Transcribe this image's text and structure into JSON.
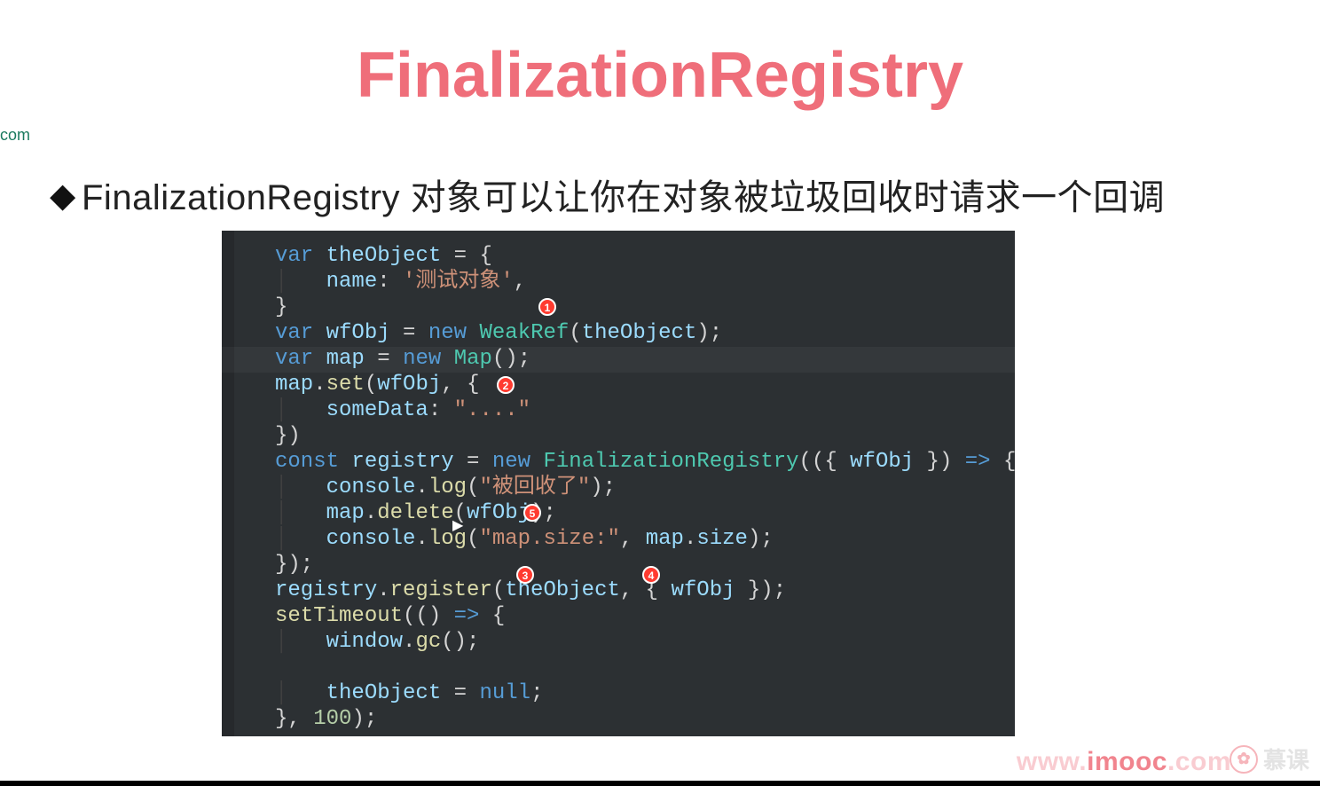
{
  "title": "FinalizationRegistry",
  "left_fragment": "com",
  "bullet_marker": "◆",
  "bullet_text": "FinalizationRegistry 对象可以让你在对象被垃圾回收时请求一个回调",
  "annotations": {
    "a1": "1",
    "a2": "2",
    "a3": "3",
    "a4": "4",
    "a5": "5"
  },
  "cursor_glyph": "▶",
  "watermark": {
    "prefix": "www.",
    "main": "imooc",
    "suffix": ".com"
  },
  "logo": {
    "glyph": "✿",
    "text": "慕课"
  },
  "code": {
    "l1_kw": "var",
    "l1_var": "theObject",
    "l1_rest": " = {",
    "l2_prop": "name",
    "l2_colon": ":",
    "l2_str": "'测试对象'",
    "l2_comma": ",",
    "l3": "}",
    "l4_kw": "var",
    "l4_var": "wfObj",
    "l4_eq": " = ",
    "l4_new": "new",
    "l4_cls": "WeakRef",
    "l4_open": "(",
    "l4_arg": "theObject",
    "l4_close": ");",
    "l5_kw": "var",
    "l5_var": "map",
    "l5_eq": " = ",
    "l5_new": "new",
    "l5_cls": "Map",
    "l5_close": "();",
    "l6_obj": "map",
    "l6_dot": ".",
    "l6_fn": "set",
    "l6_open": "(",
    "l6_arg": "wfObj",
    "l6_rest": ", {",
    "l7_prop": "someData",
    "l7_colon": ":",
    "l7_str": "\"....\"",
    "l8": "})",
    "l9_kw": "const",
    "l9_var": "registry",
    "l9_eq": " = ",
    "l9_new": "new",
    "l9_cls": "FinalizationRegistry",
    "l9_open": "(({ ",
    "l9_p": "wfObj",
    "l9_mid": " }) ",
    "l9_arrow": "=>",
    "l9_end": " {",
    "l10_obj": "console",
    "l10_dot": ".",
    "l10_fn": "log",
    "l10_open": "(",
    "l10_str": "\"被回收了\"",
    "l10_close": ");",
    "l11_obj": "map",
    "l11_dot": ".",
    "l11_fn": "delete",
    "l11_open": "(",
    "l11_arg": "wfObj",
    "l11_close": ");",
    "l12_obj": "console",
    "l12_dot": ".",
    "l12_fn": "log",
    "l12_open": "(",
    "l12_str": "\"map.size:\"",
    "l12_comma": ", ",
    "l12_a": "map",
    "l12_d2": ".",
    "l12_p": "size",
    "l12_close": ");",
    "l13": "});",
    "l14_obj": "registry",
    "l14_dot": ".",
    "l14_fn": "register",
    "l14_open": "(",
    "l14_a1": "theObject",
    "l14_mid": ", { ",
    "l14_a2": "wfObj",
    "l14_end": " });",
    "l15_fn": "setTimeout",
    "l15_open": "(() ",
    "l15_arrow": "=>",
    "l15_end": " {",
    "l16_obj": "window",
    "l16_dot": ".",
    "l16_fn": "gc",
    "l16_close": "();",
    "l17": "",
    "l18_var": "theObject",
    "l18_eq": " = ",
    "l18_null": "null",
    "l18_semi": ";",
    "l19_close": "}, ",
    "l19_num": "100",
    "l19_end": ");"
  }
}
